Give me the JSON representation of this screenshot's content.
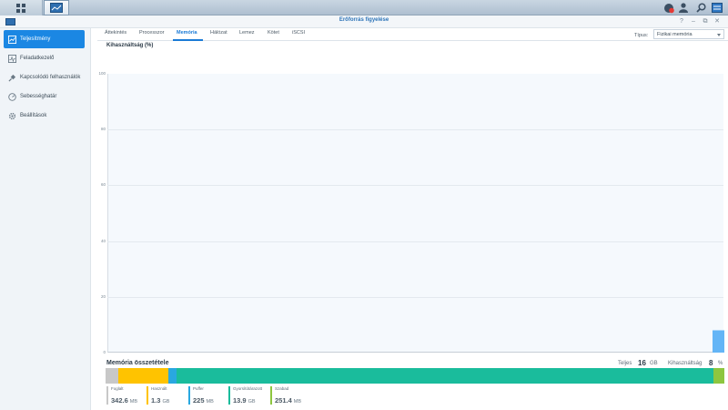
{
  "window": {
    "title": "Erőforrás figyelése"
  },
  "sidebar": {
    "items": [
      {
        "label": "Teljesítmény",
        "active": true
      },
      {
        "label": "Feladatkezelő"
      },
      {
        "label": "Kapcsolódó felhasználók"
      },
      {
        "label": "Sebességhatár"
      },
      {
        "label": "Beállítások"
      }
    ]
  },
  "tabs": [
    "Áttekintés",
    "Processzor",
    "Memória",
    "Hálózat",
    "Lemez",
    "Kötet",
    "iSCSI"
  ],
  "active_tab": "Memória",
  "type": {
    "label": "Típus:",
    "value": "Fizikai memória"
  },
  "chart_title": "Kihasználtság (%)",
  "chart_data": {
    "type": "area",
    "title": "Kihasználtság (%)",
    "ylabel": "",
    "ylim": [
      0,
      100
    ],
    "yticks": [
      "100",
      "80",
      "60",
      "40",
      "20",
      "0"
    ],
    "series": [
      {
        "values": [
          8
        ]
      }
    ],
    "grid": true
  },
  "composition": {
    "title": "Memória összetétele",
    "total_label": "Teljes",
    "total_value": "16",
    "total_unit": "GB",
    "util_label": "Kihasználtság",
    "util_value": "8",
    "util_unit": "%",
    "segments": [
      {
        "label": "Foglalt",
        "value": "342.6",
        "unit": "MB",
        "color": "#c8c8c8"
      },
      {
        "label": "Használt",
        "value": "1.3",
        "unit": "GB",
        "color": "#ffc300"
      },
      {
        "label": "Puffer",
        "value": "225",
        "unit": "MB",
        "color": "#29a8e0"
      },
      {
        "label": "Gyorsítótárazott",
        "value": "13.9",
        "unit": "GB",
        "color": "#1abc9c"
      },
      {
        "label": "Szabad",
        "value": "251.4",
        "unit": "MB",
        "color": "#8dc63f"
      }
    ]
  },
  "colors": {
    "accent": "#1b87e3",
    "chart_fill": "#64b5f6"
  }
}
